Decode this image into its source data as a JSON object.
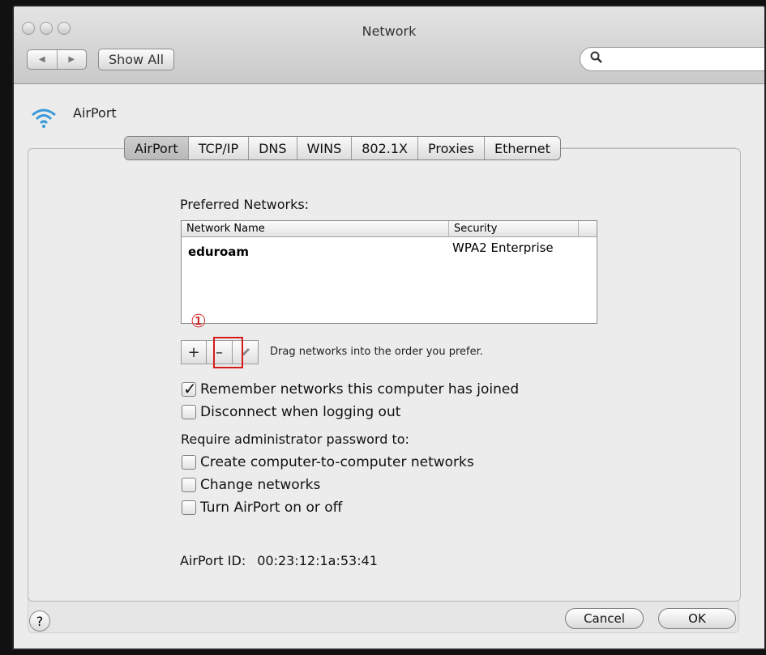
{
  "window": {
    "title": "Network"
  },
  "toolbar": {
    "back_glyph": "◀",
    "forward_glyph": "▶",
    "show_all_label": "Show All",
    "search_placeholder": ""
  },
  "header": {
    "service_label": "AirPort"
  },
  "tabs": [
    {
      "label": "AirPort",
      "selected": true
    },
    {
      "label": "TCP/IP"
    },
    {
      "label": "DNS"
    },
    {
      "label": "WINS"
    },
    {
      "label": "802.1X"
    },
    {
      "label": "Proxies"
    },
    {
      "label": "Ethernet"
    }
  ],
  "preferred": {
    "label": "Preferred Networks:",
    "columns": [
      "Network Name",
      "Security"
    ],
    "rows": [
      {
        "name": "eduroam",
        "security": "WPA2 Enterprise"
      }
    ],
    "add_label": "+",
    "remove_label": "–",
    "drag_hint": "Drag networks into the order you prefer."
  },
  "annotation": {
    "marker": "①",
    "color": "#d61b1b"
  },
  "options": {
    "remember": {
      "label": "Remember networks this computer has joined",
      "checked": true
    },
    "disconnect": {
      "label": "Disconnect when logging out",
      "checked": false
    },
    "require_label": "Require administrator password to:",
    "create": {
      "label": "Create computer-to-computer networks",
      "checked": false
    },
    "change": {
      "label": "Change networks",
      "checked": false
    },
    "toggle": {
      "label": "Turn AirPort on or off",
      "checked": false
    }
  },
  "airport_id": {
    "label": "AirPort ID:",
    "value": "00:23:12:1a:53:41"
  },
  "footer": {
    "help_label": "?",
    "cancel_label": "Cancel",
    "ok_label": "OK"
  },
  "icons": [
    "wifi-icon",
    "search-icon",
    "pencil-icon",
    "help-icon"
  ]
}
